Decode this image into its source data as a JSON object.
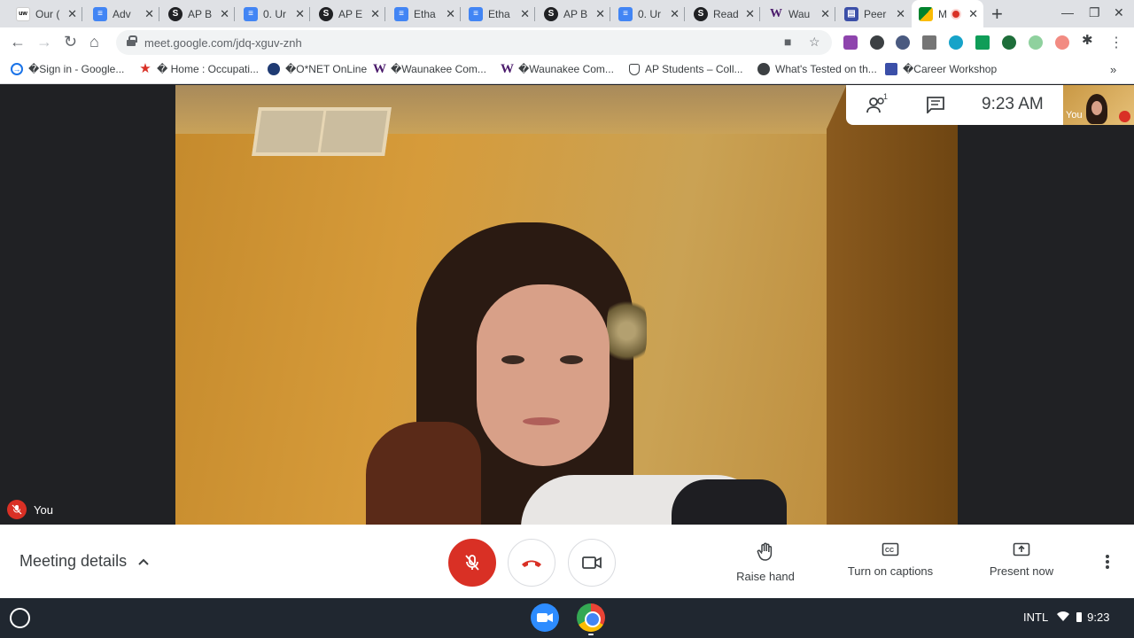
{
  "browser": {
    "tabs": [
      {
        "label": "Our (",
        "favicon": "uw-icon"
      },
      {
        "label": "Adv",
        "favicon": "docs-icon"
      },
      {
        "label": "AP B",
        "favicon": "s-icon"
      },
      {
        "label": "0. Ur",
        "favicon": "docs-icon"
      },
      {
        "label": "AP E",
        "favicon": "s-icon"
      },
      {
        "label": "Etha",
        "favicon": "docs-icon"
      },
      {
        "label": "Etha",
        "favicon": "docs-icon"
      },
      {
        "label": "AP B",
        "favicon": "s-icon"
      },
      {
        "label": "0. Ur",
        "favicon": "docs-icon"
      },
      {
        "label": "Read",
        "favicon": "s-icon"
      },
      {
        "label": "Wau",
        "favicon": "w-icon"
      },
      {
        "label": "Peer",
        "favicon": "peer-icon"
      },
      {
        "label": "M",
        "favicon": "meet-icon",
        "active": true
      }
    ],
    "url": "meet.google.com/jdq-xguv-znh",
    "bookmarks": [
      {
        "label": "�Sign in - Google...",
        "icon": "arrow-circle-icon",
        "color": "#1a73e8"
      },
      {
        "label": "� Home : Occupati...",
        "icon": "star-icon",
        "color": "#d93025"
      },
      {
        "label": "�O*NET OnLine",
        "icon": "onet-icon",
        "color": "#1f3b73"
      },
      {
        "label": "�Waunakee Com...",
        "icon": "w-icon",
        "color": "#4a1a6b"
      },
      {
        "label": "�Waunakee Com...",
        "icon": "w-icon",
        "color": "#4a1a6b"
      },
      {
        "label": "AP Students – Coll...",
        "icon": "shield-icon",
        "color": "#3c4043"
      },
      {
        "label": "What's Tested on th...",
        "icon": "globe-icon",
        "color": "#3c4043"
      },
      {
        "label": "�Career Workshop",
        "icon": "forms-icon",
        "color": "#3b4fa8"
      }
    ]
  },
  "meet": {
    "self_label": "You",
    "mini_self_label": "You",
    "time": "9:23  AM",
    "participant_count": "1",
    "meeting_details_label": "Meeting details",
    "actions": {
      "raise_hand": "Raise hand",
      "captions": "Turn on captions",
      "present": "Present now"
    }
  },
  "shelf": {
    "input_method": "INTL",
    "clock": "9:23"
  },
  "colors": {
    "accent_red": "#d93025",
    "chrome_blue": "#1a73e8"
  }
}
